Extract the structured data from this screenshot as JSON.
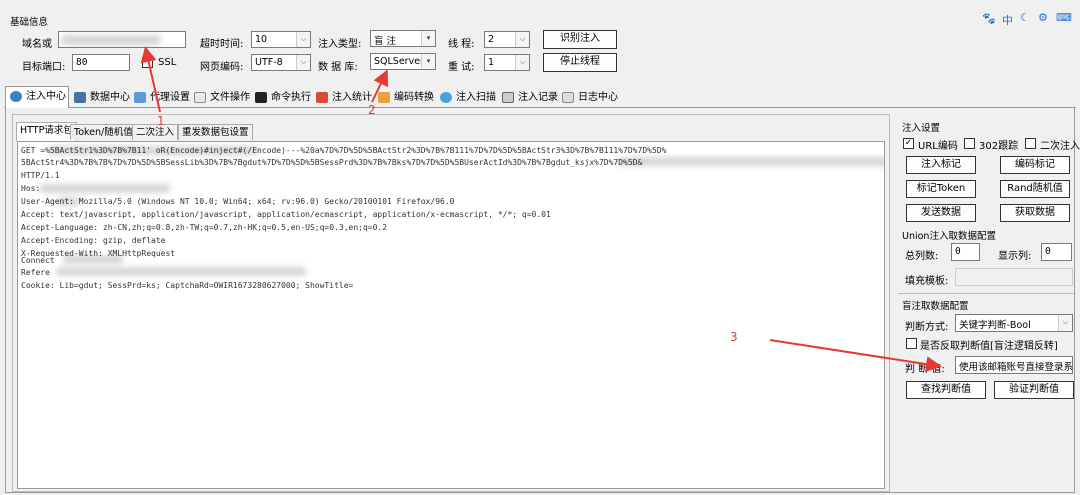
{
  "window": {
    "group_title": "基础信息",
    "top_right": "中"
  },
  "basic": {
    "domain_label": "域名或",
    "port_label": "目标端口:",
    "port_value": "80",
    "ssl_label": "SSL",
    "timeout_label": "超时时间:",
    "timeout_value": "10",
    "encoding_label": "网页编码:",
    "encoding_value": "UTF-8",
    "inject_type_label": "注入类型:",
    "inject_type_value": "盲 注",
    "db_label": "数 据 库:",
    "db_value": "SQLServer",
    "threads_label": "线 程:",
    "threads_value": "2",
    "retry_label": "重 试:",
    "retry_value": "1",
    "identify_btn": "识别注入",
    "stop_btn": "停止线程"
  },
  "tabs": [
    "注入中心",
    "数据中心",
    "代理设置",
    "文件操作",
    "命令执行",
    "注入统计",
    "编码转换",
    "注入扫描",
    "注入记录",
    "日志中心"
  ],
  "subtabs": [
    "HTTP请求包",
    "Token/随机值",
    "二次注入",
    "重发数据包设置"
  ],
  "request": {
    "line1": "GET                                                         =%5BActStr1%3D%7B%7B11' oR(Encode)#inject#(/Encode)---%20a%7D%7D%5D%5BActStr2%3D%7B%7B111%7D%7D%5D%5BActStr3%3D%7B%7B111%7D%7D%5D%",
    "line2": "5BActStr4%3D%7B%7B%7D%7D%5D%5BSessLib%3D%7B%7Bgdut%7D%7D%5D%5BSessPrd%3D%7B%7Bks%7D%7D%5D%5BUserActId%3D%7B%7Bgdut_ksjx%7D%7D%5D&",
    "line3": "HTTP/1.1",
    "line4": "Hos:",
    "line5": "User-Agent: Mozilla/5.0 (Windows NT 10.0; Win64; x64; rv:96.0) Gecko/20100101 Firefox/96.0",
    "line6": "Accept: text/javascript, application/javascript, application/ecmascript, application/x-ecmascript, */*; q=0.01",
    "line7": "Accept-Language: zh-CN,zh;q=0.8,zh-TW;q=0.7,zh-HK;q=0.5,en-US;q=0.3,en;q=0.2",
    "line8": "Accept-Encoding: gzip, deflate",
    "line9": "X-Requested-With: XMLHttpRequest",
    "line10": "Connect",
    "line11": "Refere",
    "line12": "Cookie: Lib=gdut; SessPrd=ks; CaptchaRd=OWIR1673280627000; ShowTitle="
  },
  "inject_settings": {
    "title": "注入设置",
    "url_encode": "URL编码",
    "follow302": "302跟踪",
    "second_inject": "二次注入",
    "mark_inject": "注入标记",
    "mark_encode": "编码标记",
    "mark_token": "标记Token",
    "rand_value": "Rand随机值",
    "send_data": "发送数据",
    "get_data": "获取数据"
  },
  "union": {
    "title": "Union注入取数据配置",
    "total_cols_label": "总列数:",
    "total_cols_value": "0",
    "show_col_label": "显示列:",
    "show_col_value": "0",
    "fill_template_label": "填充模板:"
  },
  "blind": {
    "title": "盲注取数据配置",
    "judge_mode_label": "判断方式:",
    "judge_mode_value": "关键字判断-Bool",
    "reverse_label": "是否反取判断值[盲注逻辑反转]",
    "judge_value_label": "判 断 值:",
    "judge_value": "使用该邮箱账号直接登录系统",
    "find_btn": "查找判断值",
    "verify_btn": "验证判断值"
  },
  "annotations": {
    "a1": "1",
    "a2": "2",
    "a3": "3"
  },
  "colors": {
    "annotation": "#e53935",
    "accent": "#1e6fd9"
  }
}
